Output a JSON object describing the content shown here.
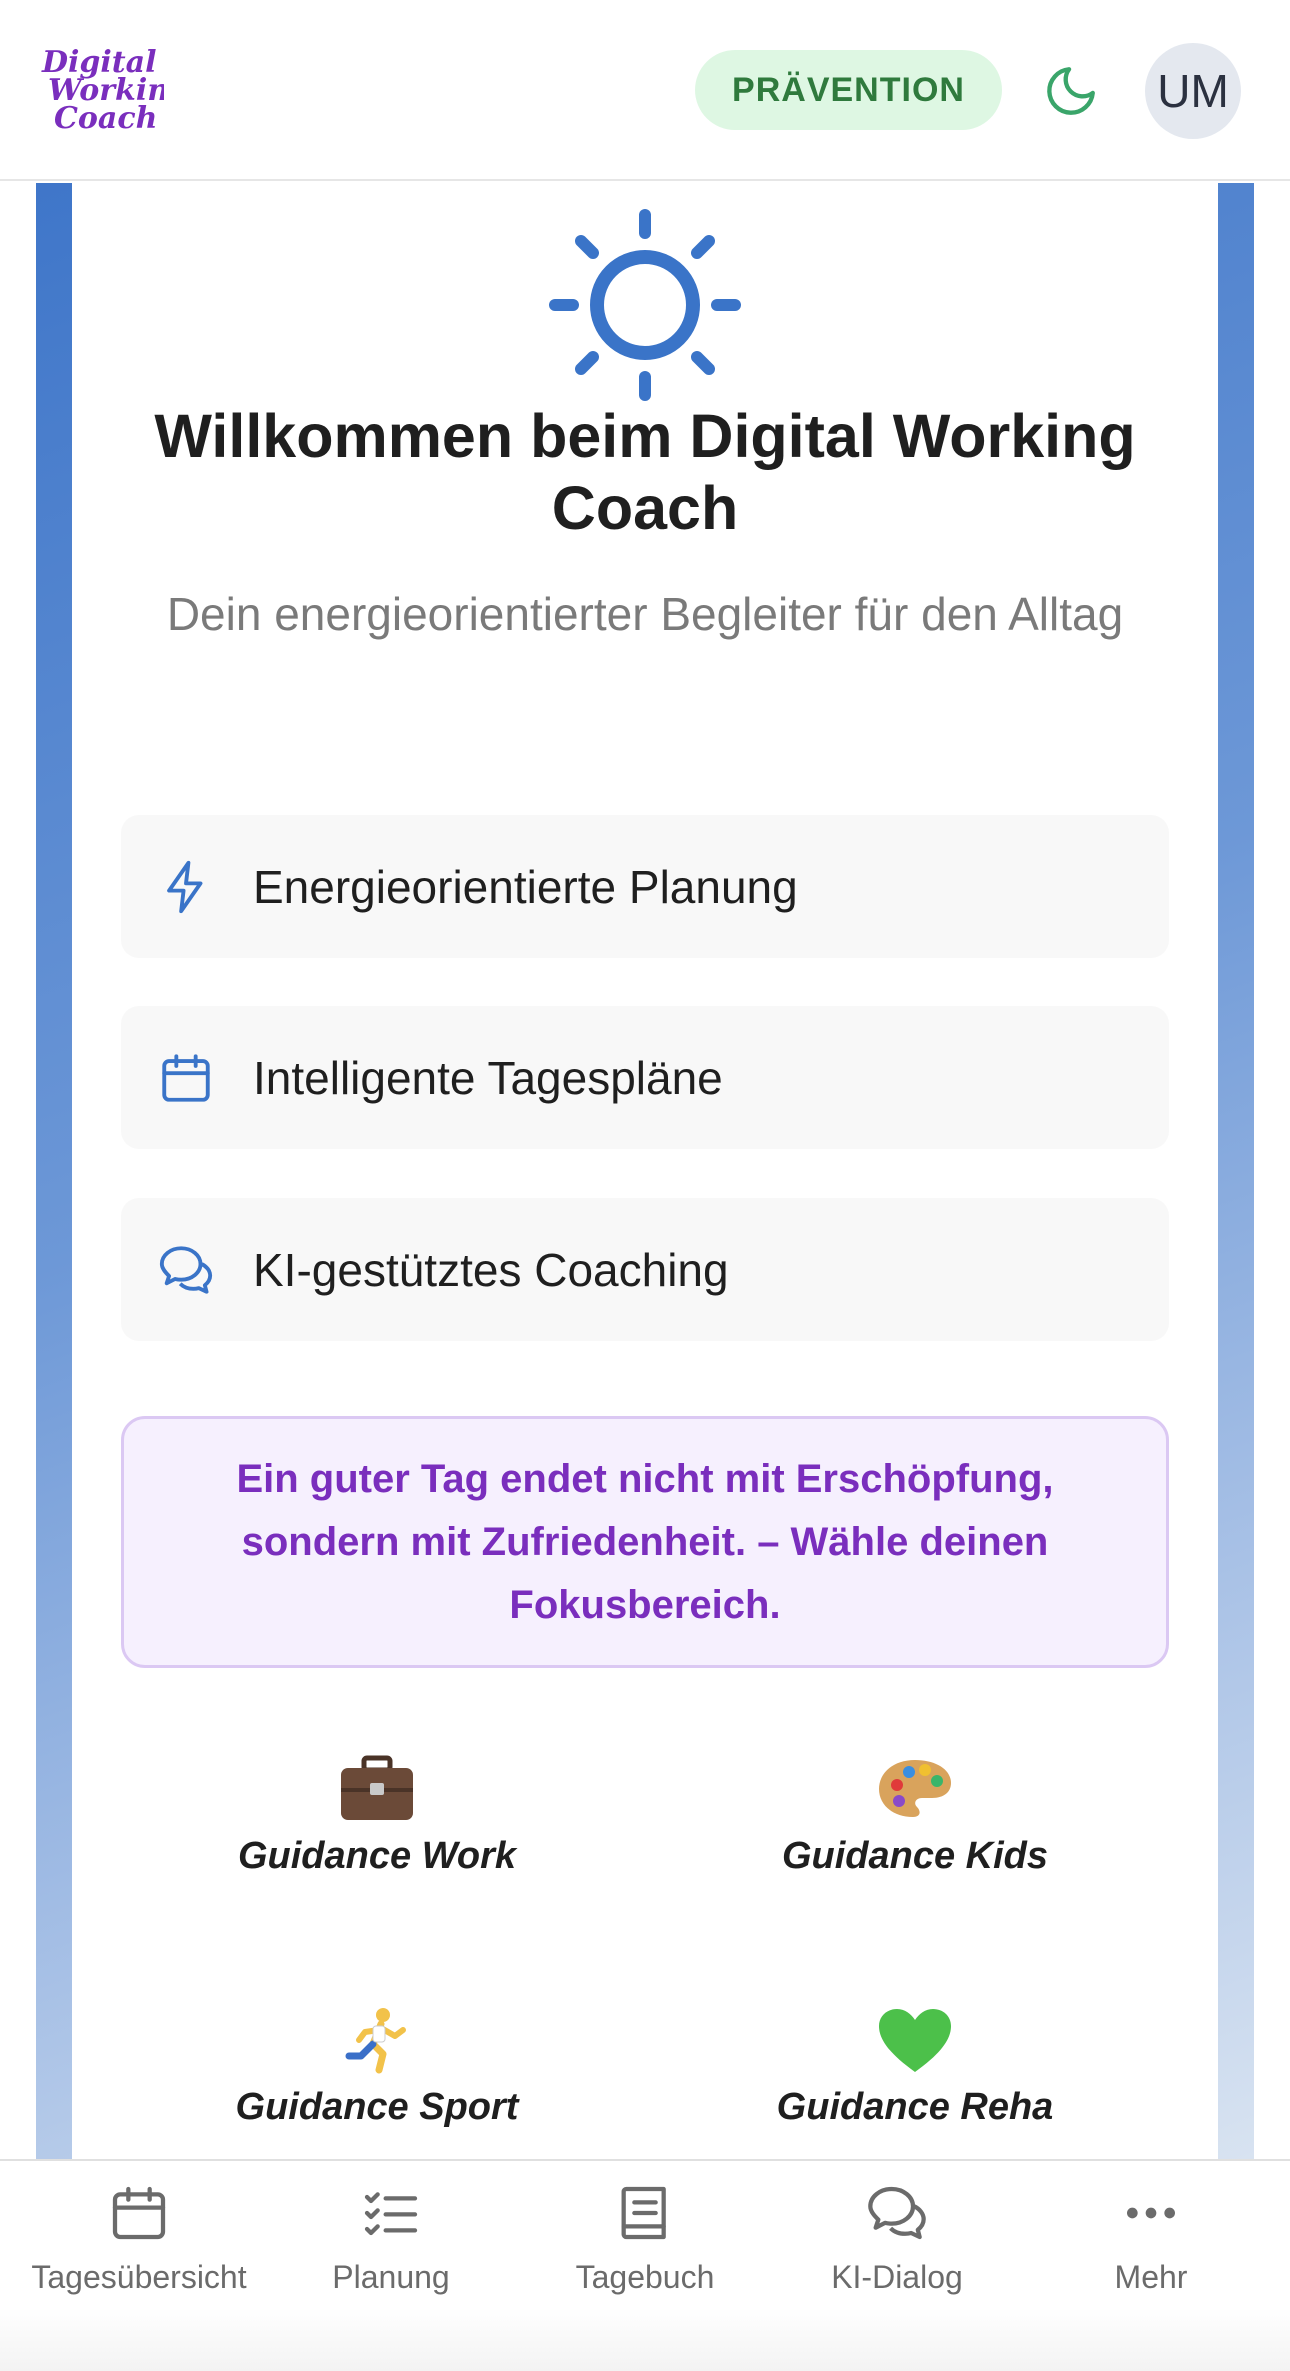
{
  "header": {
    "logo_text": [
      "Digital",
      "Working",
      "Coach"
    ],
    "badge": "PRÄVENTION",
    "avatar_initials": "UM",
    "icons": {
      "theme": "moon-icon"
    }
  },
  "hero": {
    "icon": "sun-icon",
    "title": "Willkommen beim Digital Working Coach",
    "subtitle": "Dein energieorientierter Begleiter für den Alltag"
  },
  "features": [
    {
      "icon": "lightning-icon",
      "label": "Energieorientierte Planung"
    },
    {
      "icon": "calendar-icon",
      "label": "Intelligente Tagespläne"
    },
    {
      "icon": "chat-icon",
      "label": "KI-gestütztes Coaching"
    }
  ],
  "quote": "Ein guter Tag endet nicht mit Erschöpfung, sondern mit Zufriedenheit. – Wähle deinen Fokusbereich.",
  "guidance": [
    {
      "emoji": "briefcase",
      "label": "Guidance Work"
    },
    {
      "emoji": "palette",
      "label": "Guidance Kids"
    },
    {
      "emoji": "runner",
      "label": "Guidance Sport"
    },
    {
      "emoji": "green-heart",
      "label": "Guidance Reha"
    }
  ],
  "bottom_nav": [
    {
      "icon": "calendar-icon",
      "label": "Tagesübersicht"
    },
    {
      "icon": "checklist-icon",
      "label": "Planung"
    },
    {
      "icon": "book-icon",
      "label": "Tagebuch"
    },
    {
      "icon": "chat-icon",
      "label": "KI-Dialog"
    },
    {
      "icon": "more-icon",
      "label": "Mehr"
    }
  ],
  "colors": {
    "accent_blue": "#3a74c8",
    "badge_bg": "#def7e3",
    "badge_text": "#2f7a3d",
    "quote_text": "#7a2ebd",
    "logo_purple": "#7a2ebd"
  }
}
